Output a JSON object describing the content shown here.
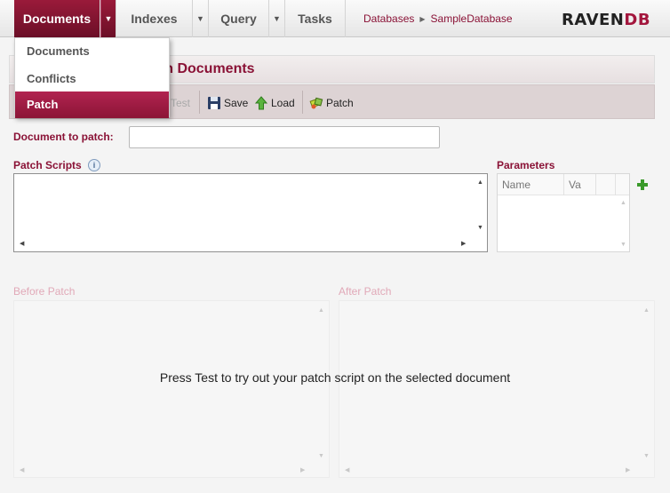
{
  "nav": {
    "documents": "Documents",
    "indexes": "Indexes",
    "query": "Query",
    "tasks": "Tasks",
    "breadcrumb": [
      "Databases",
      "SampleDatabase"
    ],
    "logo_main": "RAVEN",
    "logo_accent": "DB"
  },
  "menu": {
    "items": [
      "Documents",
      "Conflicts",
      "Patch"
    ],
    "selected": "Patch"
  },
  "page": {
    "title": "tch Documents",
    "toolbar": {
      "test": "Test",
      "save": "Save",
      "load": "Load",
      "patch": "Patch"
    },
    "doc_to_patch_label": "Document to patch:",
    "doc_to_patch_value": "",
    "patch_scripts_label": "Patch Scripts",
    "parameters_label": "Parameters",
    "param_columns": [
      "Name",
      "Va"
    ],
    "before_patch_label": "Before Patch",
    "after_patch_label": "After Patch",
    "hint": "Press Test to try out your patch script on the selected document"
  },
  "colors": {
    "accent": "#8a1236",
    "active_nav": "#7d1330"
  }
}
